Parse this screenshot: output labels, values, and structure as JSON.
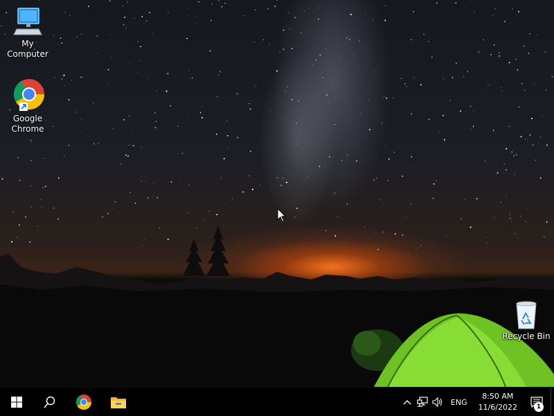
{
  "desktop": {
    "icons": [
      {
        "label": "My Computer",
        "icon": "monitor-icon"
      },
      {
        "label": "Google Chrome",
        "icon": "chrome-icon"
      },
      {
        "label": "Recycle Bin",
        "icon": "recycle-bin-icon"
      }
    ]
  },
  "taskbar": {
    "buttons": [
      "start-button",
      "search-button",
      "chrome-taskbar-button",
      "file-explorer-button"
    ],
    "tray": {
      "icons": [
        "chevron-up-icon",
        "network-icon",
        "volume-icon"
      ],
      "language": "ENG",
      "time": "8:50 AM",
      "date": "11/6/2022",
      "notification_count": "1"
    }
  },
  "colors": {
    "taskbar": "#000000",
    "tent": "#7ad22a",
    "glow": "#ff7a1e"
  }
}
